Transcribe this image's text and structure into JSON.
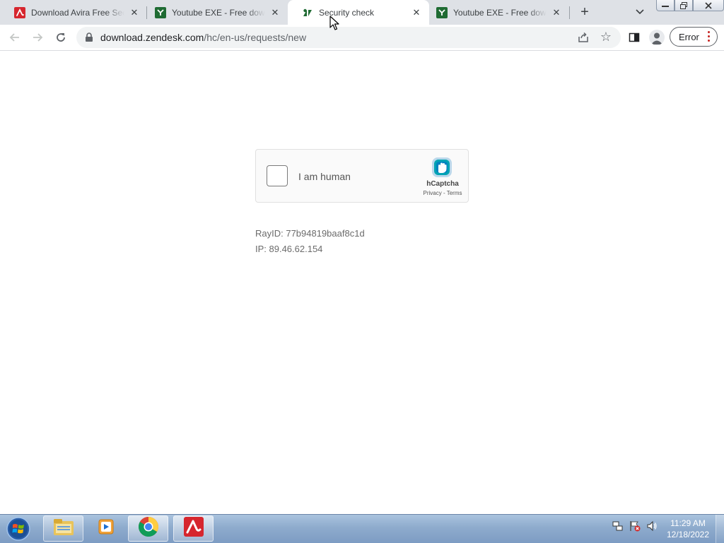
{
  "browser": {
    "tabs": [
      {
        "title": "Download Avira Free Security",
        "favicon": "avira-icon",
        "active": false
      },
      {
        "title": "Youtube EXE - Free download",
        "favicon": "zendesk-icon",
        "active": false
      },
      {
        "title": "Security check",
        "favicon": "zendesk-icon",
        "active": true
      },
      {
        "title": "Youtube EXE - Free download",
        "favicon": "zendesk-icon",
        "active": false
      }
    ],
    "url_host": "download.zendesk.com",
    "url_path": "/hc/en-us/requests/new",
    "error_label": "Error"
  },
  "page": {
    "captcha": {
      "checkbox_label": "I am human",
      "brand": "hCaptcha",
      "privacy": "Privacy",
      "separator": " - ",
      "terms": "Terms"
    },
    "ray_id": "RayID: 77b94819baaf8c1d",
    "ip": "IP: 89.46.62.154"
  },
  "taskbar": {
    "items": [
      "windows-explorer-icon",
      "media-player-icon",
      "chrome-icon",
      "avira-icon"
    ],
    "time": "11:29 AM",
    "date": "12/18/2022"
  },
  "colors": {
    "avira_red": "#d6262e",
    "zendesk_green": "#1f6b33",
    "hcaptcha_teal": "#0074bf",
    "error_dot": "#c5221f"
  }
}
